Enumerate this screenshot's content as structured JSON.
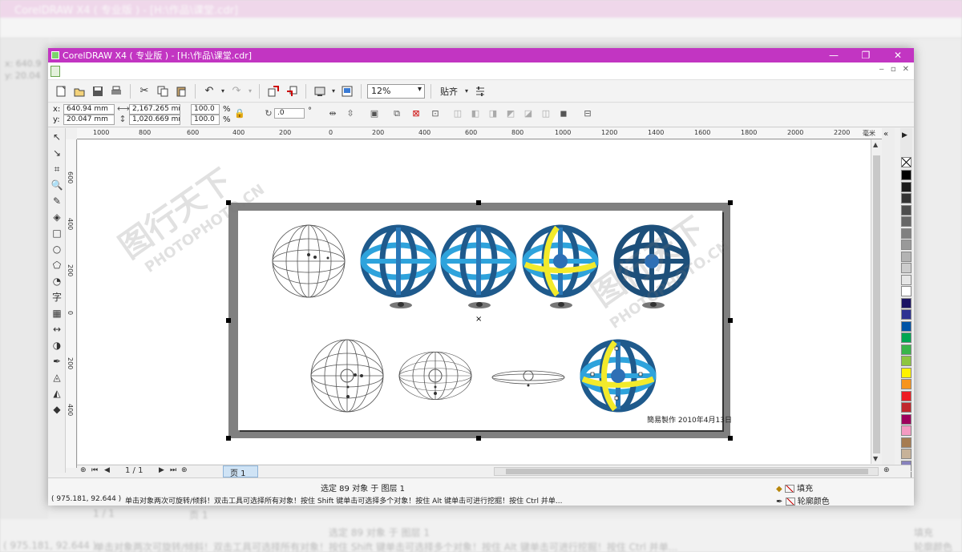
{
  "background": {
    "title": "CorelDRAW X4 ( 专业版 ) - [H:\\作品\\课堂.cdr]",
    "coords": [
      "x: 640.9",
      "y: 20.04"
    ],
    "page_label": "1 / 1",
    "page_tab": "页 1",
    "status_main": "选定 89 对象 于 图层 1",
    "status_coords": "( 975.181, 92.644 )",
    "status_hint": "单击对象两次可旋转/倾斜！双击工具可选择所有对象！按住 Shift 键单击可选择多个对象！按住 Alt 键单击可进行挖掘！按住 Ctrl 并单...",
    "fill_label": "填充",
    "outline_label": "轮廓颜色"
  },
  "window": {
    "title": "CorelDRAW X4 ( 专业版 ) - [H:\\作品\\课堂.cdr]",
    "btn_min": "—",
    "btn_max": "❐",
    "btn_close": "✕",
    "mdi_min": "‒",
    "mdi_max": "▫",
    "mdi_close": "✕"
  },
  "toolbar": {
    "zoom": "12%",
    "snap": "贴齐"
  },
  "properties": {
    "x_label": "x:",
    "y_label": "y:",
    "x_value": "640.94 mm",
    "y_value": "20.047 mm",
    "width": "2,167.265 mm",
    "height": "1,020.669 mm",
    "scale_w": "100.0",
    "scale_h": "100.0",
    "percent": "%",
    "rotation": ".0",
    "degree": "°"
  },
  "ruler": {
    "h_ticks": [
      "1000",
      "800",
      "600",
      "400",
      "200",
      "0",
      "200",
      "400",
      "600",
      "800",
      "1000",
      "1200",
      "1400",
      "1600",
      "1800",
      "2000",
      "2200"
    ],
    "h_unit": "毫米",
    "v_ticks": [
      "600",
      "400",
      "200",
      "0",
      "200",
      "400"
    ]
  },
  "canvas": {
    "date_text": "簡易製作 2010年4月13日",
    "watermark_lines": [
      "图行天下",
      "PHOTOPHOTO.CN"
    ]
  },
  "pagenav": {
    "counter": "1 / 1",
    "tab": "页 1"
  },
  "status": {
    "main": "选定 89 对象 于 图层 1",
    "coords": "( 975.181, 92.644 )",
    "hint": "单击对象两次可旋转/倾斜！双击工具可选择所有对象！按住 Shift 键单击可选择多个对象！按住 Alt 键单击可进行挖掘！按住 Ctrl 并单...",
    "fill": "填充",
    "outline": "轮廓颜色"
  },
  "colors": {
    "titlebar": "#c235c2",
    "globe_dark": "#1f5a8c",
    "globe_light": "#2ea3dc",
    "globe_yellow": "#f2ea2b",
    "palette": [
      "#000000",
      "#1a1a1a",
      "#333333",
      "#4d4d4d",
      "#666666",
      "#808080",
      "#999999",
      "#b3b3b3",
      "#cccccc",
      "#e6e6e6",
      "#ffffff",
      "#1b1464",
      "#2e3192",
      "#0054a6",
      "#00a651",
      "#39b54a",
      "#8dc63f",
      "#fff200",
      "#f7941d",
      "#ed1c24",
      "#c1272d",
      "#9e005d",
      "#f49ac2",
      "#a67c52",
      "#c7b299",
      "#8781bd",
      "#605ca8"
    ]
  }
}
